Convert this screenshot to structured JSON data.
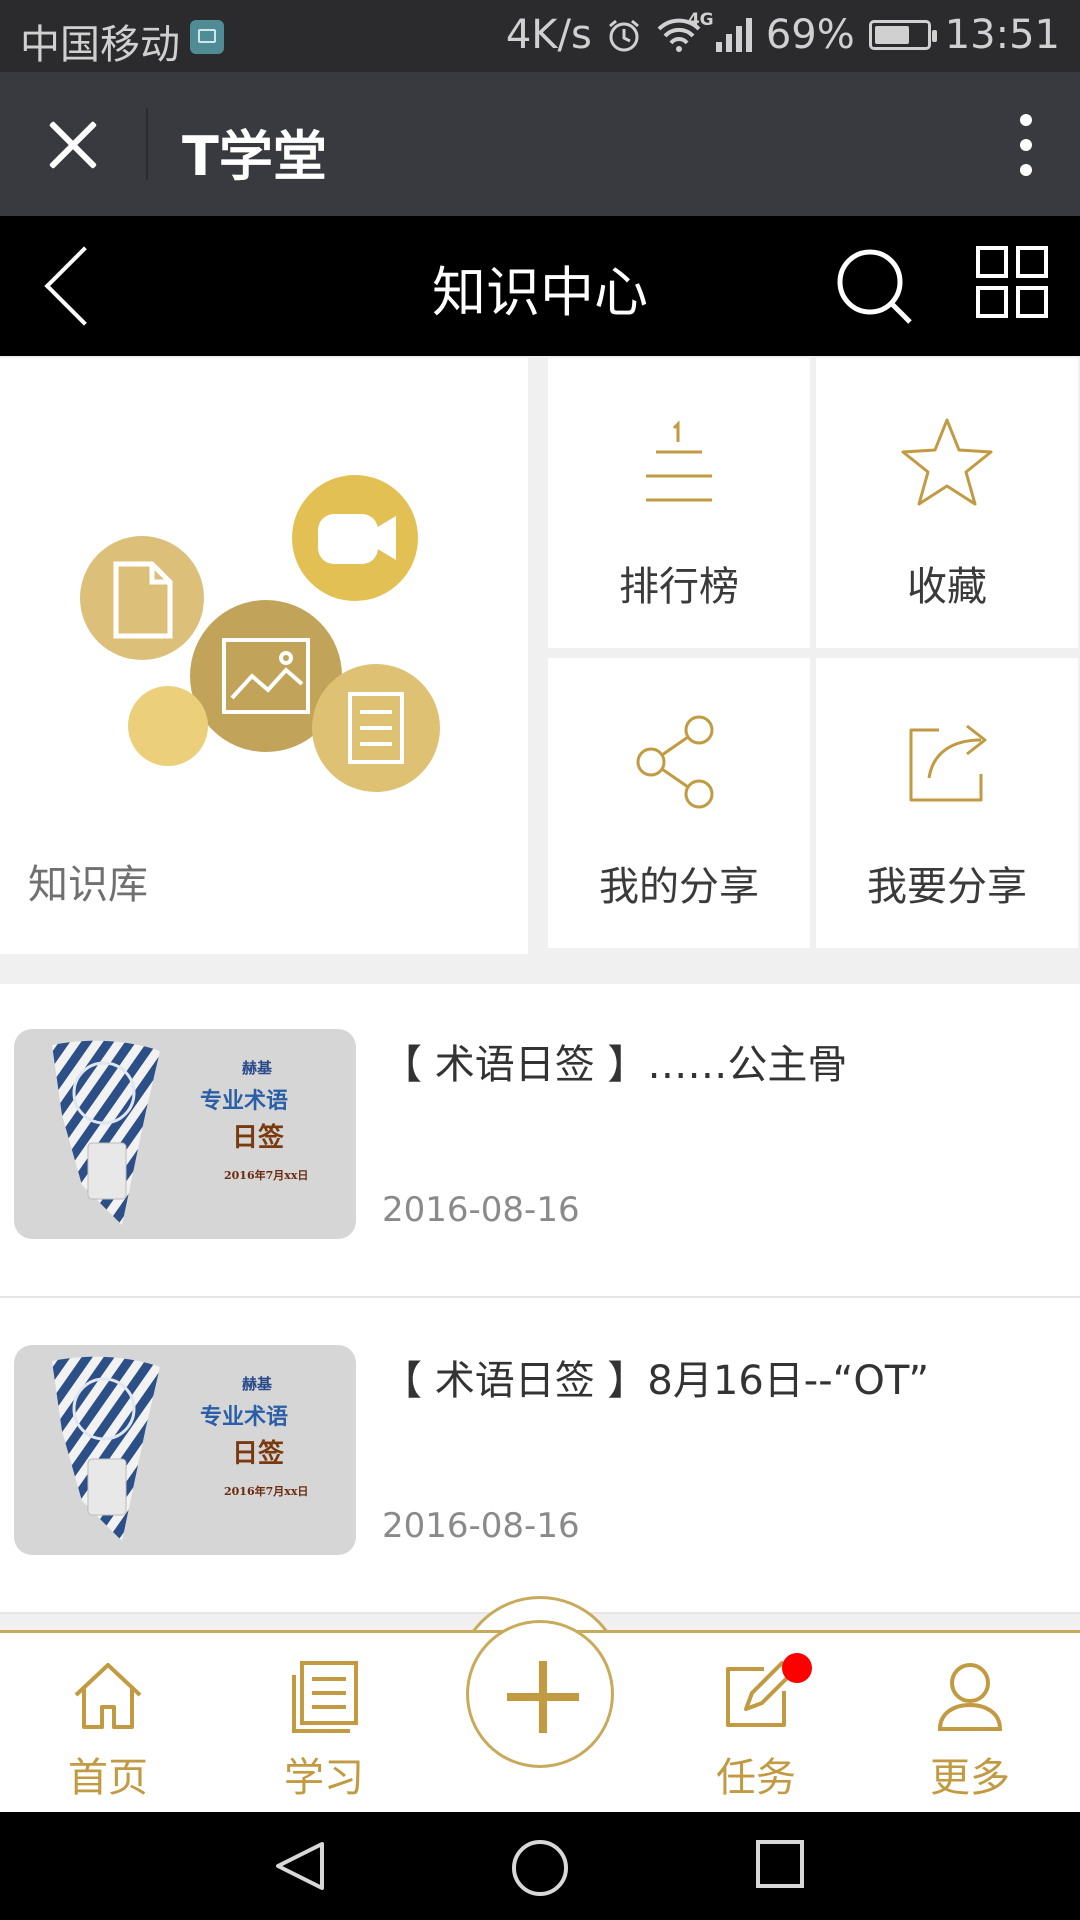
{
  "status_bar": {
    "carrier": "中国移动",
    "speed": "4K/s",
    "network": "4G",
    "battery": "69%",
    "battery_level": 0.69,
    "time": "13:51"
  },
  "wechat_bar": {
    "title": "T学堂"
  },
  "header": {
    "title": "知识中心"
  },
  "quick": {
    "library_label": "知识库",
    "tiles": [
      {
        "label": "排行榜",
        "icon": "ranking-icon"
      },
      {
        "label": "收藏",
        "icon": "star-icon"
      },
      {
        "label": "我的分享",
        "icon": "share-icon"
      },
      {
        "label": "我要分享",
        "icon": "share-out-icon"
      }
    ]
  },
  "articles": [
    {
      "title": "【 术语日签 】……公主骨",
      "date": "2016-08-16",
      "thumb": {
        "brand": "赫基",
        "line1": "专业术语",
        "line2": "日签",
        "line3": "2016年7月xx日",
        "tag": "日签"
      }
    },
    {
      "title": "【 术语日签 】8月16日--“OT”",
      "date": "2016-08-16",
      "thumb": {
        "brand": "赫基",
        "line1": "专业术语",
        "line2": "日签",
        "line3": "2016年7月xx日",
        "tag": "日签"
      }
    }
  ],
  "tabbar": {
    "tabs": [
      {
        "label": "首页",
        "icon": "home-icon"
      },
      {
        "label": "学习",
        "icon": "study-icon"
      },
      {
        "label": "任务",
        "icon": "task-icon",
        "badge": true
      },
      {
        "label": "更多",
        "icon": "user-icon"
      }
    ]
  },
  "colors": {
    "gold": "#c19a42",
    "dark_bar": "#393a3f",
    "badge": "#ff0000"
  }
}
